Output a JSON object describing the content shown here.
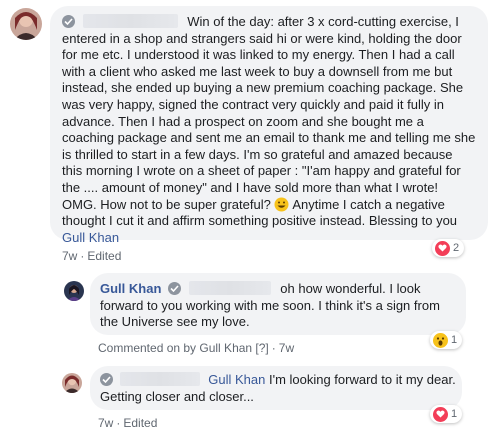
{
  "comment1": {
    "text": "Win of the day: after 3 x cord-cutting exercise, I entered in a shop and strangers said hi or were kind, holding the door for me etc. I understood it was linked to my energy. Then I had a call with a client who asked me last week to buy a downsell from me but instead, she ended up buying a new premium coaching package. She was very happy, signed the contract very quickly and paid it fully in advance. Then I had a prospect on zoom and she bought me a coaching package and sent me an email to thank me and telling me she is thrilled to start in a few days. I'm so grateful and amazed because this morning I wrote on a sheet of paper : \"I'am happy and grateful for the .... amount of money\" and I have sold more than what I wrote! OMG. How not to be super grateful?",
    "text_after_emoji": "Anytime I catch a negative thought I cut it and affirm something positive instead. Blessing to you",
    "mention": "Gull Khan",
    "time": "7w",
    "edited": "Edited",
    "reaction_count": "2"
  },
  "reply1": {
    "author": "Gull Khan",
    "text": "oh how wonderful. I look forward to you working with me soon. I think it's a sign from the Universe see my love.",
    "commented_on": "Commented on by Gull Khan [?]",
    "time": "7w",
    "reaction_count": "1"
  },
  "reply2": {
    "mention": "Gull Khan",
    "text": "I'm looking forward to it my dear. Getting closer and closer...",
    "time": "7w",
    "edited": "Edited",
    "reaction_count": "1"
  },
  "colors": {
    "link": "#385898",
    "bubble": "#f2f3f5",
    "love": "#f33e58",
    "meta": "#606770"
  }
}
